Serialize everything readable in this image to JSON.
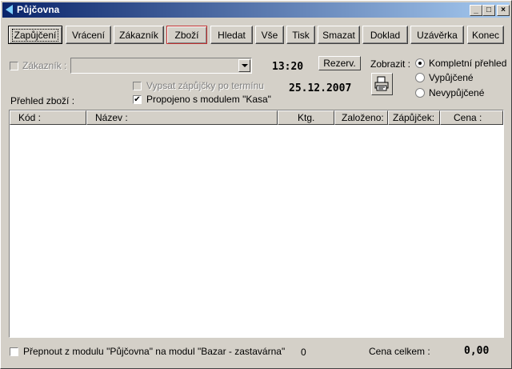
{
  "window": {
    "title": "Půjčovna",
    "min": "_",
    "max": "□",
    "close": "×"
  },
  "toolbar": [
    {
      "label": "Zapůjčení",
      "state": "active"
    },
    {
      "label": "Vrácení",
      "state": ""
    },
    {
      "label": "Zákazník",
      "state": ""
    },
    {
      "label": "Zboží",
      "state": "red"
    },
    {
      "label": "Hledat",
      "state": ""
    },
    {
      "label": "Vše",
      "state": ""
    },
    {
      "label": "Tisk",
      "state": ""
    },
    {
      "label": "Smazat",
      "state": ""
    },
    {
      "label": "Doklad",
      "state": ""
    },
    {
      "label": "Uzávěrka",
      "state": ""
    },
    {
      "label": "Konec",
      "state": ""
    }
  ],
  "filter": {
    "customer_label": "Zákazník :",
    "customer_value": "",
    "time": "13:20",
    "date": "25.12.2007",
    "reserve_label": "Rezerv.",
    "list_due_label": "Vypsat zápůjčky po termínu",
    "linked_label": "Propojeno s modulem \"Kasa\"",
    "linked_checked": "✔",
    "overview_label": "Přehled zboží :",
    "show_label": "Zobrazit :",
    "radio": [
      "Kompletní přehled",
      "Vypůjčené",
      "Nevypůjčené"
    ]
  },
  "table": {
    "columns": [
      "Kód :",
      "Název :",
      "Ktg.",
      "Založeno:",
      "Zápůjček:",
      "Cena :"
    ]
  },
  "footer": {
    "switch_label": "Přepnout z modulu \"Půjčovna\" na modul \"Bazar - zastavárna\"",
    "count": "0",
    "total_label": "Cena celkem :",
    "total_value": "0,00"
  },
  "colors": {
    "titlebar_start": "#0a246a",
    "titlebar_end": "#a6caf0",
    "face": "#d4d0c8"
  },
  "icons": {
    "app": "arrow-left-icon",
    "print": "printer-icon"
  }
}
